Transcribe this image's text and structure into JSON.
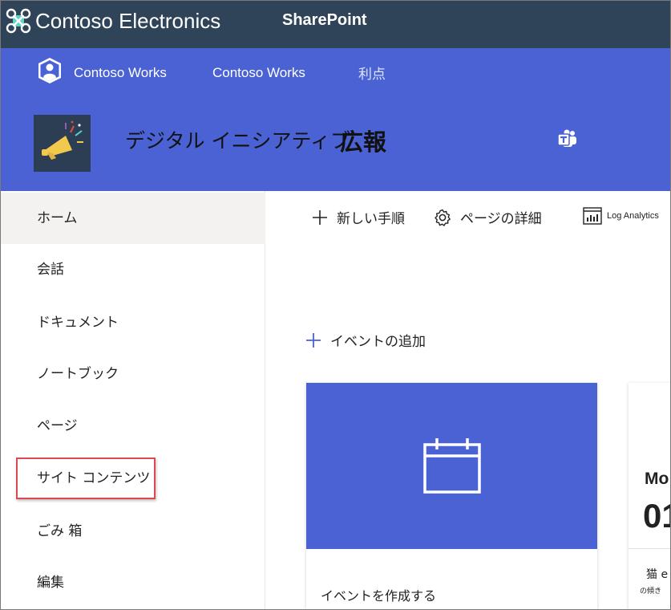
{
  "suite_bar": {
    "org_name": "Contoso Electronics",
    "app_name": "SharePoint",
    "background": "#2f4459"
  },
  "hub_nav": {
    "items": [
      {
        "label": "Contoso Works"
      },
      {
        "label": "Contoso Works"
      },
      {
        "label": "利点"
      }
    ],
    "background": "#4a62d4"
  },
  "site_header": {
    "title": "デジタル イニシアティブ",
    "title_bold": "広報",
    "logo_icon": "megaphone-icon",
    "teams_icon": "teams-icon"
  },
  "left_nav": {
    "items": [
      {
        "label": "ホーム",
        "active": true
      },
      {
        "label": "会話"
      },
      {
        "label": "ドキュメント"
      },
      {
        "label": "ノートブック"
      },
      {
        "label": "ページ"
      },
      {
        "label": "サイト コンテンツ",
        "highlighted": true
      },
      {
        "label": "ごみ 箱"
      },
      {
        "label": "編集"
      }
    ]
  },
  "command_bar": {
    "new_label": "新しい手順",
    "page_details_label": "ページの詳細",
    "log_analytics_label": "Log Analytics"
  },
  "events": {
    "add_label": "イベントの追加",
    "create_card_label": "イベントを作成する",
    "card2_month": "Mo",
    "card2_day": "01",
    "card2_title": "猫 e",
    "card2_sub": "の傾き"
  },
  "colors": {
    "accent": "#4a62d4",
    "highlight_box": "#e0474f"
  }
}
